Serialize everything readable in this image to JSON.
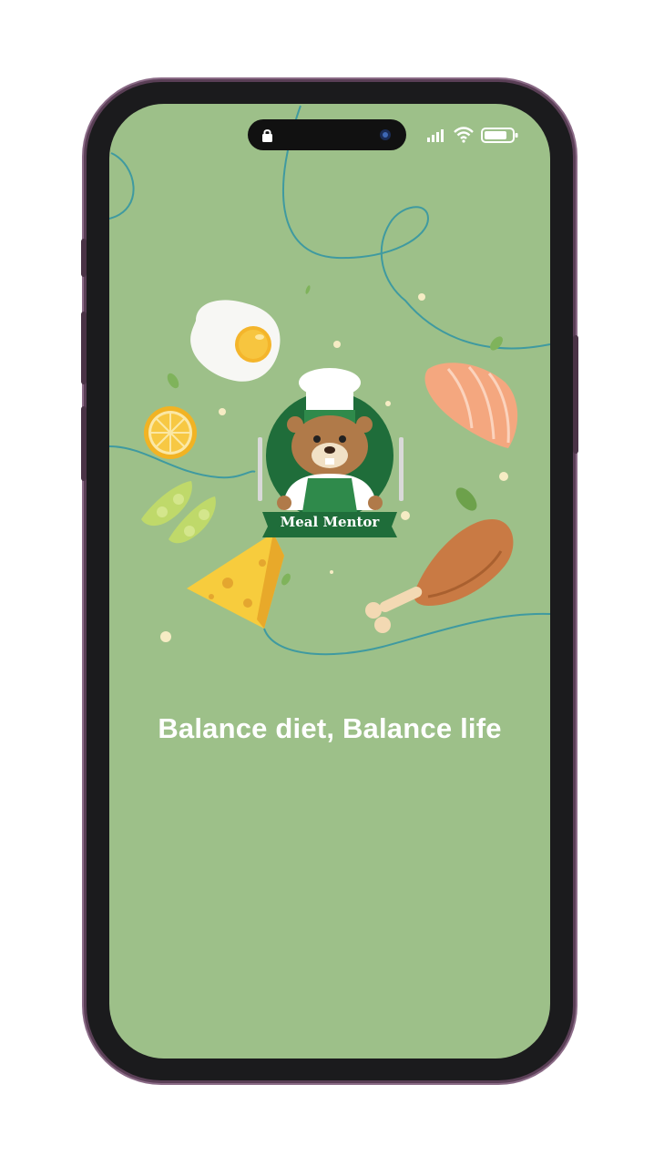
{
  "app": {
    "logo_text": "Meal Mentor",
    "tagline": "Balance diet, Balance life"
  },
  "status_bar": {
    "lock_icon": "lock-icon",
    "camera_icon": "front-camera-icon",
    "signal_icon": "signal-icon",
    "wifi_icon": "wifi-icon",
    "battery_icon": "battery-icon"
  },
  "colors": {
    "screen_background": "#9dc089",
    "accent_green": "#1f7a3e",
    "tagline": "#ffffff"
  },
  "illustrations": [
    "fried-egg",
    "lemon-slice",
    "edamame",
    "cheese",
    "salmon",
    "chicken-leg",
    "beaver-chef-logo"
  ]
}
